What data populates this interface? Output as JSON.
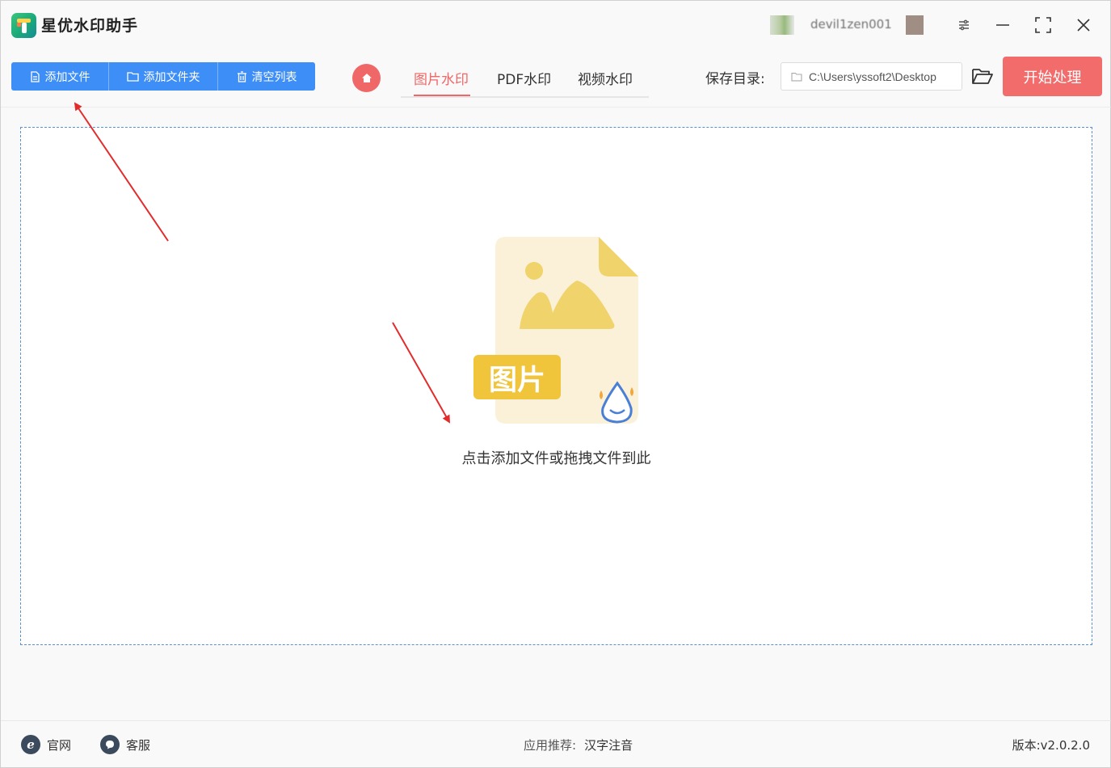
{
  "app": {
    "title": "星优水印助手",
    "user_name": "devil1zen001"
  },
  "toolbar": {
    "add_file": "添加文件",
    "add_folder": "添加文件夹",
    "clear_list": "清空列表"
  },
  "tabs": [
    {
      "label": "图片水印",
      "active": true
    },
    {
      "label": "PDF水印",
      "active": false
    },
    {
      "label": "视频水印",
      "active": false
    }
  ],
  "save": {
    "label": "保存目录:",
    "path": "C:\\Users\\yssoft2\\Desktop"
  },
  "start_button": "开始处理",
  "dropzone": {
    "badge": "图片",
    "hint": "点击添加文件或拖拽文件到此"
  },
  "footer": {
    "website": "官网",
    "support": "客服",
    "recommend_label": "应用推荐:",
    "recommend_app": "汉字注音",
    "version": "版本:v2.0.2.0"
  },
  "colors": {
    "primary_blue": "#3e8ef7",
    "accent_red": "#f06767",
    "start_red": "#f26c6c",
    "illustration_yellow": "#f0d36a"
  },
  "icons": [
    "app-logo-icon",
    "file-icon",
    "folder-icon",
    "trash-icon",
    "home-icon",
    "folder-open-icon",
    "minimize-icon",
    "maximize-icon",
    "close-icon",
    "settings-icon",
    "ie-icon",
    "chat-icon",
    "water-drop-icon"
  ]
}
